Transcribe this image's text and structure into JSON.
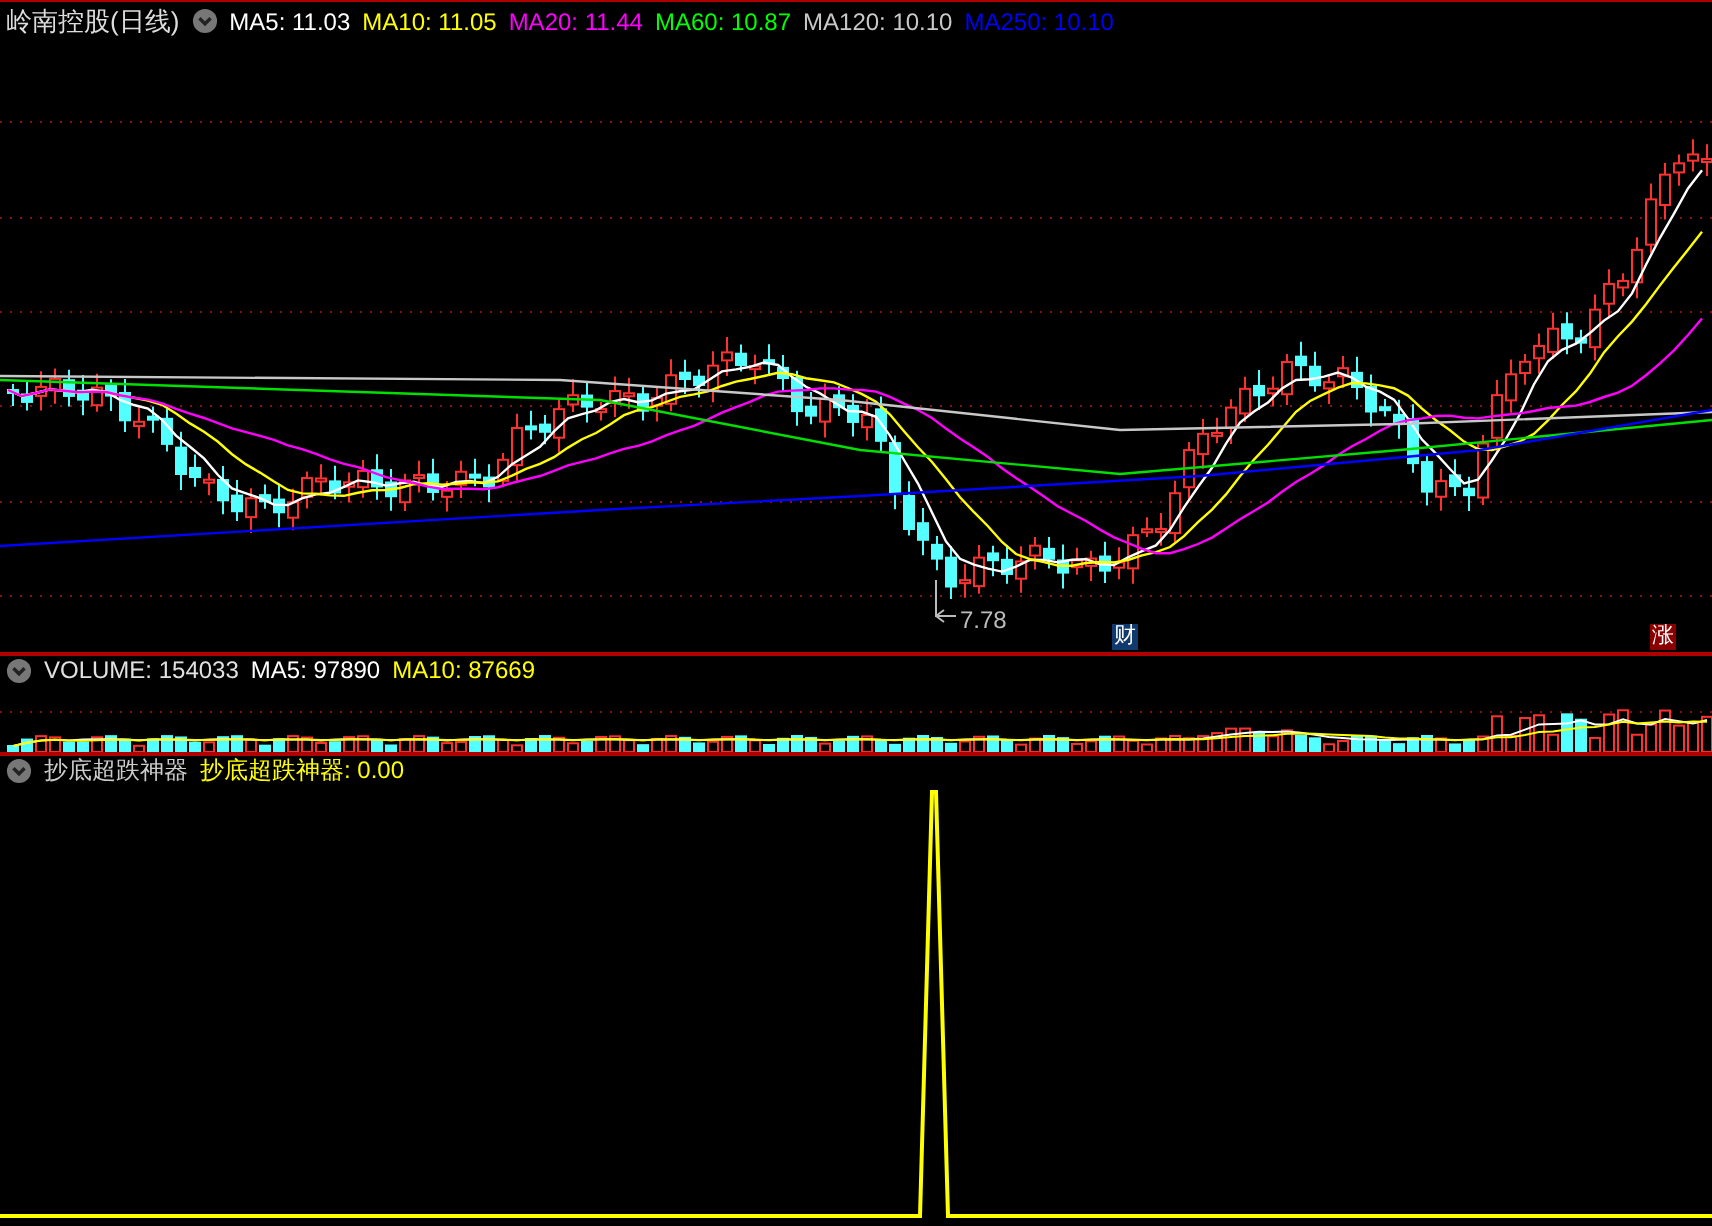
{
  "title": "岭南控股(日线)",
  "ma_legend": [
    {
      "text": "MA5: 11.03",
      "color": "#ffffff"
    },
    {
      "text": "MA10: 11.05",
      "color": "#ffff00"
    },
    {
      "text": "MA20: 11.44",
      "color": "#ff00ff"
    },
    {
      "text": "MA60: 10.87",
      "color": "#00ff00"
    },
    {
      "text": "MA120: 10.10",
      "color": "#c8c8c8"
    },
    {
      "text": "MA250: 10.10",
      "color": "#0000ff"
    }
  ],
  "low_label": "7.78",
  "event_tags": [
    {
      "text": "财",
      "kind": "finance"
    },
    {
      "text": "涨",
      "kind": "limit_up"
    }
  ],
  "volume": {
    "text": "VOLUME: 154033",
    "legend": [
      {
        "text": "MA5: 97890",
        "color": "#ffffff"
      },
      {
        "text": "MA10: 87669",
        "color": "#ffff00"
      }
    ]
  },
  "indicator": {
    "name": "抄底超跌神器",
    "legend": [
      {
        "text": "抄底超跌神器: 0.00",
        "color": "#ffff00"
      }
    ]
  }
}
